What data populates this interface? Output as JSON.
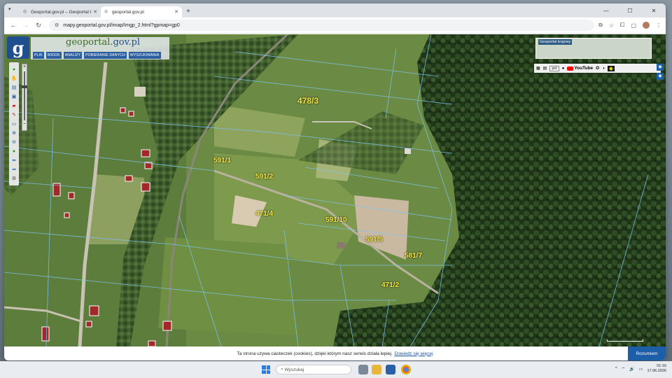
{
  "browser": {
    "tabs": [
      {
        "title": "Geoportal.gov.pl – Geoportal Infr"
      },
      {
        "title": "geoportal.gov.pl"
      }
    ],
    "url": "mapy.geoportal.gov.pl/imap/Imgp_2.html?gpmap=gp0"
  },
  "app": {
    "logo_letter": "g",
    "brand_main": "geoportal",
    "brand_suffix": ".gov.pl",
    "menu": [
      "PLIK",
      "WIDOK",
      "ANALIZY",
      "POBIERANIE DANYCH",
      "WYSZUKIWANIA"
    ],
    "overview_title": "Geoportal krajowy",
    "lang": "pol",
    "youtube": "YouTube"
  },
  "parcels": [
    {
      "label": "478/3"
    },
    {
      "label": "591/1"
    },
    {
      "label": "591/2"
    },
    {
      "label": "471/4"
    },
    {
      "label": "591/10"
    },
    {
      "label": "591/5"
    },
    {
      "label": "581/7"
    },
    {
      "label": "471/2"
    }
  ],
  "cookie": {
    "text": "Ta strona używa ciasteczek (cookies), dzięki którym nasz serwis działa lepiej.",
    "link": "Dowiedz się więcej",
    "accept": "Rozumiem"
  },
  "taskbar": {
    "search_placeholder": "Wyszukaj",
    "time": "01:16",
    "date": "17.06.2026"
  }
}
